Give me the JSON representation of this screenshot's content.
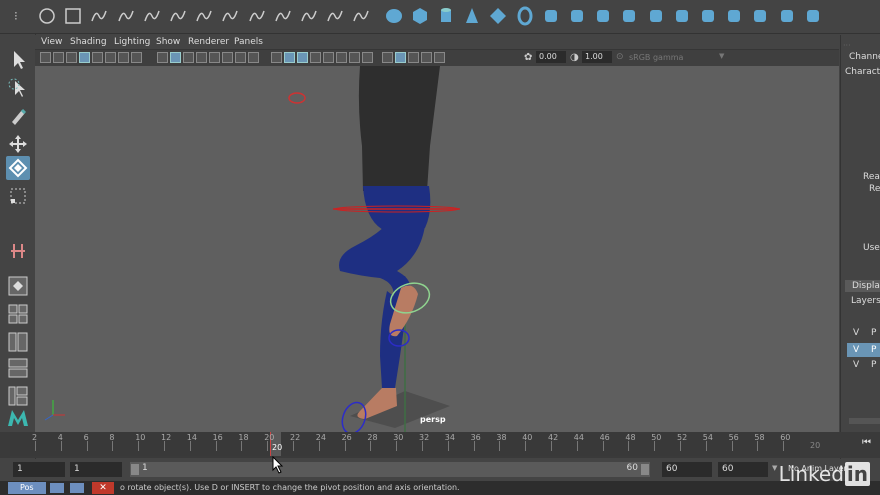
{
  "shelf": {
    "icons": [
      "polygon-circle-icon",
      "polygon-square-icon",
      "ep-curve-icon",
      "pencil-curve-icon",
      "cv-curve-icon",
      "bezier-curve-icon",
      "curve-tool-icon",
      "curve-wave-icon",
      "curve-spiral-icon",
      "arc-icon",
      "curve-dots-icon",
      "curve-s-icon",
      "curve-edit-icon",
      "sphere-icon",
      "cube-icon",
      "cylinder-icon",
      "cone-icon",
      "diamond-icon",
      "torus-icon",
      "pipe-icon",
      "helix-icon",
      "soccer-icon",
      "capsule-icon",
      "gear-icon",
      "cube-alt-icon",
      "sphere-alt-icon",
      "dotted-circle-icon",
      "cut-icon",
      "combine-icon",
      "separate-icon"
    ]
  },
  "menubar": [
    "View",
    "Shading",
    "Lighting",
    "Show",
    "Renderer",
    "Panels"
  ],
  "viewport_toolbar": {
    "field_a": "0.00",
    "field_b": "1.00",
    "color_space": "sRGB gamma"
  },
  "viewport": {
    "camera_label": "persp",
    "axis_labels": {
      "x": "x",
      "y": "y",
      "z": "z"
    }
  },
  "channel_box": {
    "title": "Channe",
    "subtitle": "Characte",
    "side_label_1": "Rea",
    "side_label_2": "Re",
    "side_label_3": "Use",
    "display_tab": "Display",
    "layers_label": "Layers",
    "layer_rows": [
      [
        "V",
        "P"
      ],
      [
        "V",
        "P"
      ],
      [
        "V",
        "P"
      ]
    ]
  },
  "timeslider": {
    "ticks": [
      "2",
      "4",
      "6",
      "8",
      "10",
      "12",
      "14",
      "16",
      "18",
      "20",
      "22",
      "24",
      "26",
      "28",
      "30",
      "32",
      "34",
      "36",
      "38",
      "40",
      "42",
      "44",
      "46",
      "48",
      "50",
      "52",
      "54",
      "56",
      "58",
      "60"
    ],
    "current_frame": "20",
    "end_label": "20"
  },
  "range": {
    "start_field": "1",
    "playback_start": "1",
    "range_start": "1",
    "range_end": "60",
    "playback_end": "60",
    "end_field": "60",
    "anim_layer": "No Anim Layer"
  },
  "status": {
    "taskbar_label": "Pos",
    "message": "o rotate object(s). Use D or INSERT to change the pivot position and axis orientation."
  },
  "watermark": {
    "brand": "Linked",
    "brand_in": "in"
  },
  "colors": {
    "selection": "#5d8fb0",
    "viewport_bg": "#5f5f5f",
    "pants": "#1e2f82",
    "shirt": "#2e2e2e",
    "skin": "#b87c63",
    "ground": "#3f6e44"
  }
}
